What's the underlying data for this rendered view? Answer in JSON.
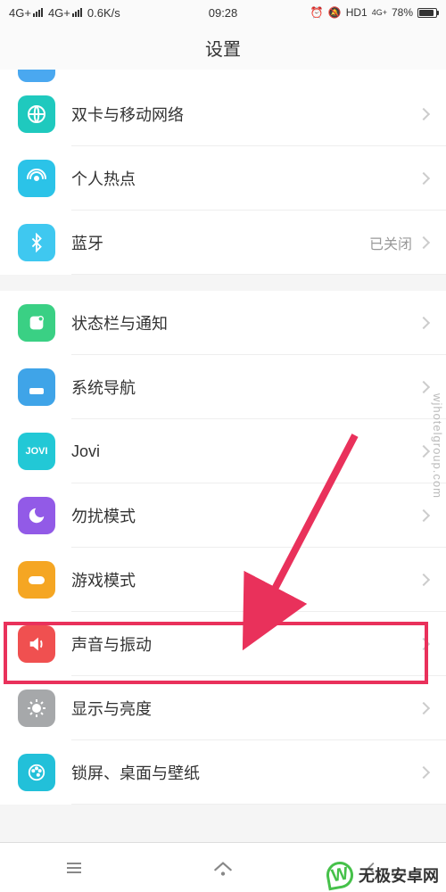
{
  "status": {
    "net1": "4G+",
    "net2": "4G+",
    "speed": "0.6K/s",
    "time": "09:28",
    "hd": "HD1",
    "net3": "4G+",
    "battery_pct": "78%"
  },
  "header": {
    "title": "设置"
  },
  "items": [
    {
      "id": "wlan-partial",
      "label": "",
      "value": ""
    },
    {
      "id": "dual-sim",
      "label": "双卡与移动网络",
      "value": ""
    },
    {
      "id": "hotspot",
      "label": "个人热点",
      "value": ""
    },
    {
      "id": "bluetooth",
      "label": "蓝牙",
      "value": "已关闭"
    },
    {
      "id": "status-notif",
      "label": "状态栏与通知",
      "value": ""
    },
    {
      "id": "sys-nav",
      "label": "系统导航",
      "value": ""
    },
    {
      "id": "jovi",
      "label": "Jovi",
      "value": ""
    },
    {
      "id": "dnd",
      "label": "勿扰模式",
      "value": ""
    },
    {
      "id": "game-mode",
      "label": "游戏模式",
      "value": ""
    },
    {
      "id": "sound",
      "label": "声音与振动",
      "value": ""
    },
    {
      "id": "display",
      "label": "显示与亮度",
      "value": ""
    },
    {
      "id": "lock-wallpaper",
      "label": "锁屏、桌面与壁纸",
      "value": ""
    }
  ],
  "watermark": {
    "side": "wjhotelgroup.com",
    "brand": "无极安卓网"
  }
}
